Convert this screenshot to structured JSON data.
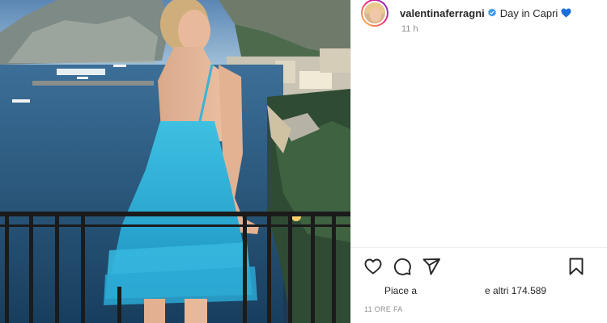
{
  "post": {
    "username": "valentinaferragni",
    "caption": "Day in Capri",
    "time_ago": "11 h",
    "likes_prefix": "Piace a",
    "likes_suffix": "e altri",
    "likes_count": "174.589",
    "timestamp": "11 ORE FA"
  },
  "icons": {
    "verified": "verified-badge-icon",
    "caption_emoji": "blue-heart-icon",
    "like": "heart-icon",
    "comment": "comment-icon",
    "share": "paper-plane-icon",
    "save": "bookmark-icon"
  },
  "colors": {
    "verified_blue": "#3897f0",
    "emoji_blue": "#1d6fd8",
    "dress": "#3ab3d6",
    "sea": "#24557a",
    "muted_text": "#8e8e8e"
  }
}
